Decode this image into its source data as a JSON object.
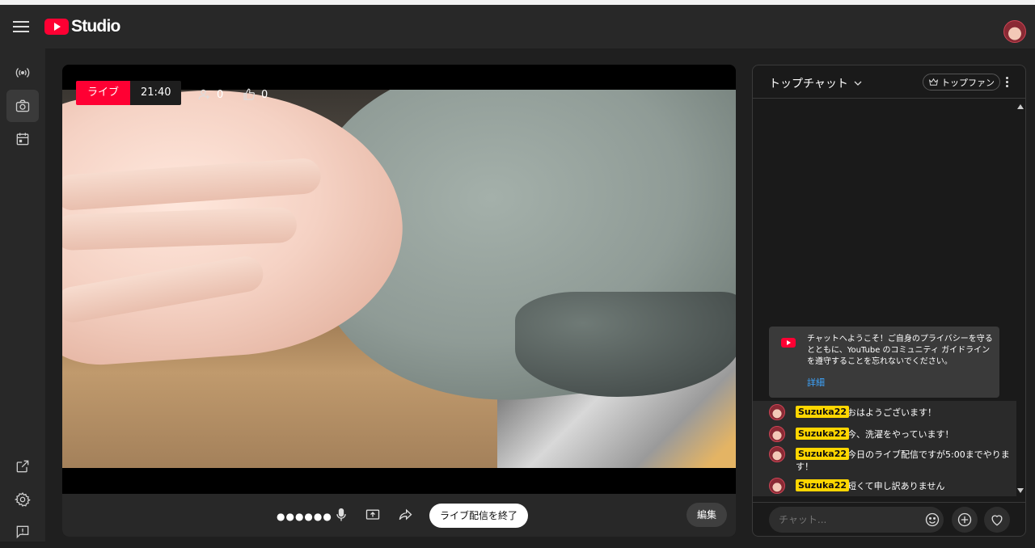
{
  "app": {
    "logo_text": "Studio",
    "brand_color": "#ff0033"
  },
  "nav": {
    "items": [
      {
        "icon": "broadcast-icon"
      },
      {
        "icon": "camera-icon",
        "active": true
      },
      {
        "icon": "calendar-icon"
      },
      {
        "icon": "external-link-icon"
      },
      {
        "icon": "gear-icon"
      },
      {
        "icon": "feedback-icon"
      }
    ]
  },
  "player": {
    "live_label": "ライブ",
    "elapsed": "21:40",
    "viewers": "0",
    "likes": "0",
    "connection_dots": "●●●●●●",
    "end_button": "ライブ配信を終了",
    "edit_button": "編集"
  },
  "chat": {
    "title": "トップチャット",
    "top_fans_label": "トップファン",
    "welcome": {
      "text": "チャットへようこそ！ご自身のプライバシーを守るとともに、YouTube のコミュニティ ガイドラインを遵守することを忘れないでください。",
      "link": "詳細"
    },
    "messages": [
      {
        "author": "Suzuka22",
        "text": "おはようございます！"
      },
      {
        "author": "Suzuka22",
        "text": "今、洗濯をやっています！"
      },
      {
        "author": "Suzuka22",
        "text": "今日のライブ配信ですが5:00までやります！"
      },
      {
        "author": "Suzuka22",
        "text": "短くて申し訳ありません"
      }
    ],
    "input_placeholder": "チャット..."
  }
}
